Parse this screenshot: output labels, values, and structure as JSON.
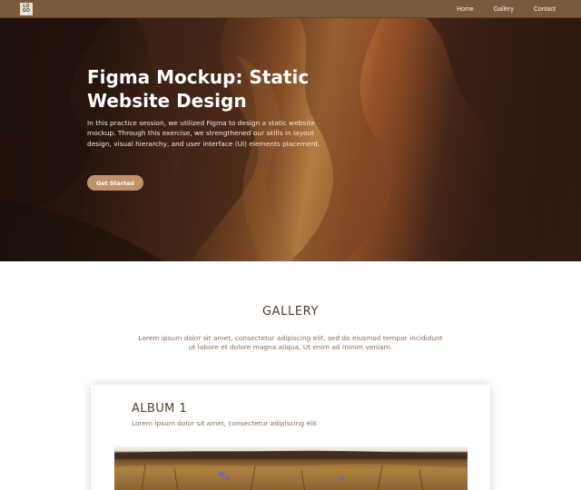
{
  "nav": {
    "logo_top": "LO",
    "logo_bottom": "GO",
    "links": [
      "Home",
      "Gallery",
      "Contact"
    ]
  },
  "hero": {
    "title": "Figma Mockup: Static Website Design",
    "description": "In this practice session, we utilized Figma to design a static website mockup. Through this exercise, we strengthened our skills in layout design, visual hierarchy, and user interface (UI) elements placement.",
    "button_label": "Get Started"
  },
  "gallery": {
    "title": "GALLERY",
    "description": "Lorem ipsum dolor sit amet, consectetur adipiscing elit, sed do eiusmod tempor incididunt ut labore et dolore magna aliqua. Ut enim ad minim veniam."
  },
  "album": {
    "title": "ALBUM 1",
    "subtitle": "Lorem ipsum dolor sit amet, consectetur adipiscing elit"
  },
  "colors": {
    "nav_bg": "#7a5a3a",
    "button_bg": "#c0926b",
    "heading_brown": "#5a3d22",
    "body_brown": "#8a6b4f"
  }
}
